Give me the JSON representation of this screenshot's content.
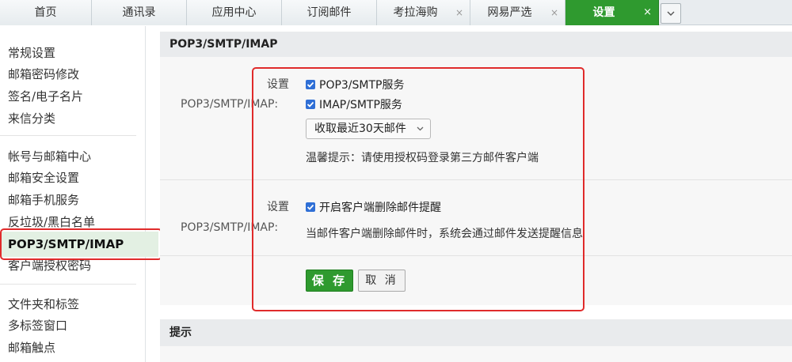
{
  "tabs": [
    {
      "label": "首页",
      "close": false
    },
    {
      "label": "通讯录",
      "close": false
    },
    {
      "label": "应用中心",
      "close": false
    },
    {
      "label": "订阅邮件",
      "close": false
    },
    {
      "label": "考拉海购",
      "close": true
    },
    {
      "label": "网易严选",
      "close": true
    },
    {
      "label": "设置",
      "close": true,
      "active": true
    }
  ],
  "tab_close_glyph": "×",
  "sidebar": {
    "groups": [
      [
        "常规设置",
        "邮箱密码修改",
        "签名/电子名片",
        "来信分类"
      ],
      [
        "帐号与邮箱中心",
        "邮箱安全设置",
        "邮箱手机服务",
        "反垃圾/黑白名单"
      ],
      [
        "POP3/SMTP/IMAP",
        "客户端授权密码"
      ],
      [
        "文件夹和标签",
        "多标签窗口",
        "邮箱触点"
      ]
    ],
    "active": "POP3/SMTP/IMAP"
  },
  "main": {
    "title": "POP3/SMTP/IMAP",
    "section1": {
      "row_label": "POP3/SMTP/IMAP:",
      "set_label": "设置",
      "options": [
        {
          "label": "POP3/SMTP服务",
          "checked": true
        },
        {
          "label": "IMAP/SMTP服务",
          "checked": true
        }
      ],
      "select_value": "收取最近30天邮件",
      "tip": "温馨提示：请使用授权码登录第三方邮件客户端"
    },
    "section2": {
      "row_label": "POP3/SMTP/IMAP:",
      "set_label": "设置",
      "option": {
        "label": "开启客户端删除邮件提醒",
        "checked": true
      },
      "desc": "当邮件客户端删除邮件时，系统会通过邮件发送提醒信息"
    },
    "save_label": "保 存",
    "cancel_label": "取 消"
  },
  "tips": {
    "title": "提示"
  },
  "colors": {
    "accent": "#2f9a2f",
    "highlight": "#e02b2b",
    "checkbox": "#2f6fd6"
  },
  "icons": {
    "dropdown": "chevron-down-icon",
    "check": "check-icon",
    "close": "close-icon"
  }
}
